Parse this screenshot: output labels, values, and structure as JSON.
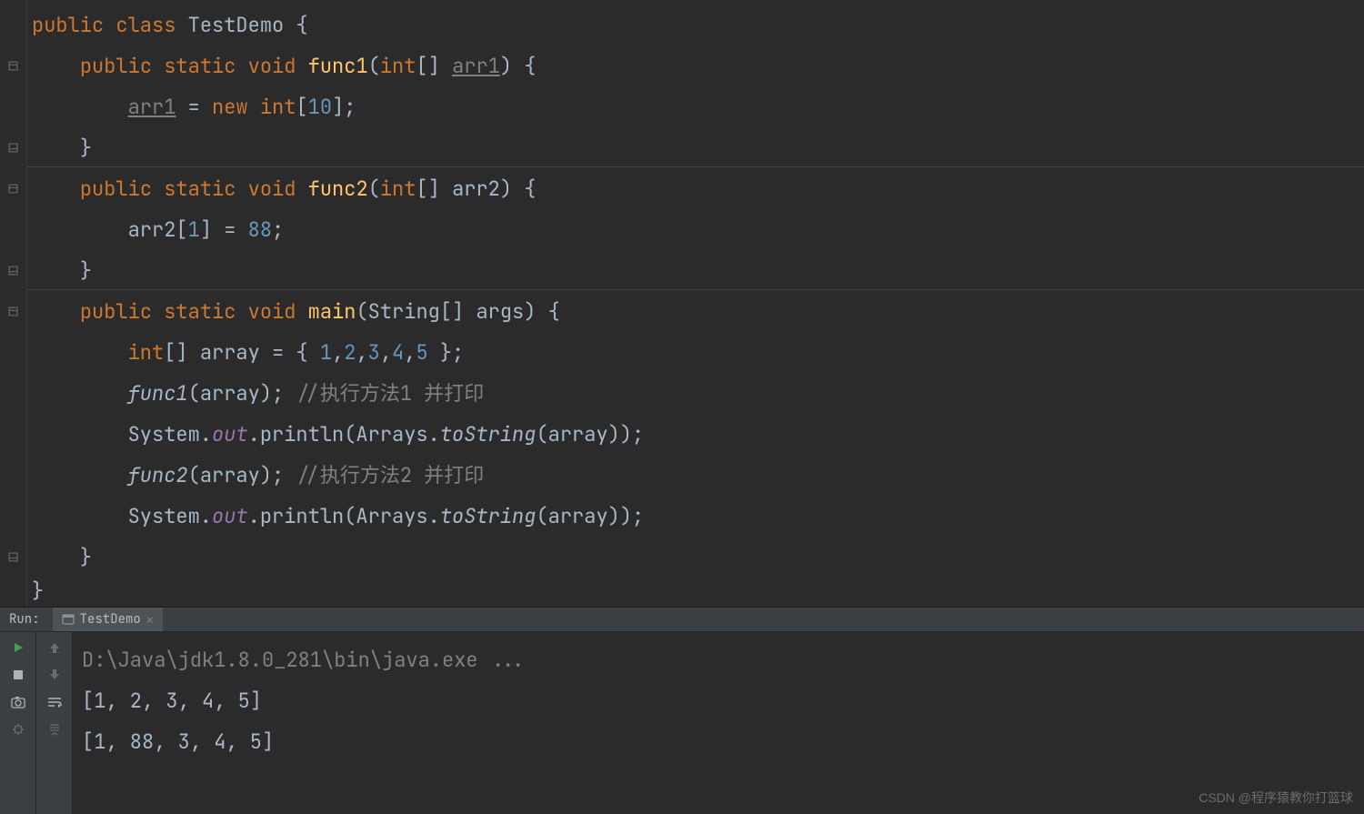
{
  "code": {
    "line1": {
      "kw1": "public",
      "kw2": "class",
      "cls": "TestDemo",
      "brace": " {"
    },
    "line2": {
      "kw1": "public",
      "kw2": "static",
      "kw3": "void",
      "fn": "func1",
      "p_open": "(",
      "type": "int",
      "brkt": "[] ",
      "param": "arr1",
      "p_close": ") {"
    },
    "line3": {
      "var": "arr1",
      "eq": " = ",
      "kw": "new",
      "type": " int",
      "br": "[",
      "num": "10",
      "end": "];"
    },
    "line4": {
      "brace": "}"
    },
    "line5": {
      "kw1": "public",
      "kw2": "static",
      "kw3": "void",
      "fn": "func2",
      "p_open": "(",
      "type": "int",
      "brkt": "[] ",
      "param": "arr2",
      "p_close": ") {"
    },
    "line6": {
      "var": "arr2[",
      "idx": "1",
      "mid": "] = ",
      "val": "88",
      "end": ";"
    },
    "line7": {
      "brace": "}"
    },
    "line8": {
      "kw1": "public",
      "kw2": "static",
      "kw3": "void",
      "fn": "main",
      "p_open": "(String[] args) {"
    },
    "line9": {
      "type": "int",
      "brkt": "[] array = { ",
      "n1": "1",
      "c": ",",
      "n2": "2",
      "n3": "3",
      "n4": "4",
      "n5": "5",
      "end": " };"
    },
    "line10": {
      "call": "func1",
      "args": "(array); ",
      "comment": "//执行方法1 并打印"
    },
    "line11": {
      "sys": "System.",
      "out": "out",
      "dot": ".println(Arrays.",
      "ts": "toString",
      "end": "(array));"
    },
    "line12": {
      "call": "func2",
      "args": "(array); ",
      "comment": "//执行方法2 并打印"
    },
    "line13": {
      "sys": "System.",
      "out": "out",
      "dot": ".println(Arrays.",
      "ts": "toString",
      "end": "(array));"
    },
    "line14": {
      "brace": "}"
    },
    "line15": {
      "brace": "}"
    }
  },
  "run": {
    "label": "Run:",
    "tab": "TestDemo",
    "cmd": "D:\\Java\\jdk1.8.0_281\\bin\\java.exe ...",
    "out1": "[1, 2, 3, 4, 5]",
    "out2": "[1, 88, 3, 4, 5]"
  },
  "watermark": "CSDN @程序猿教你打篮球"
}
